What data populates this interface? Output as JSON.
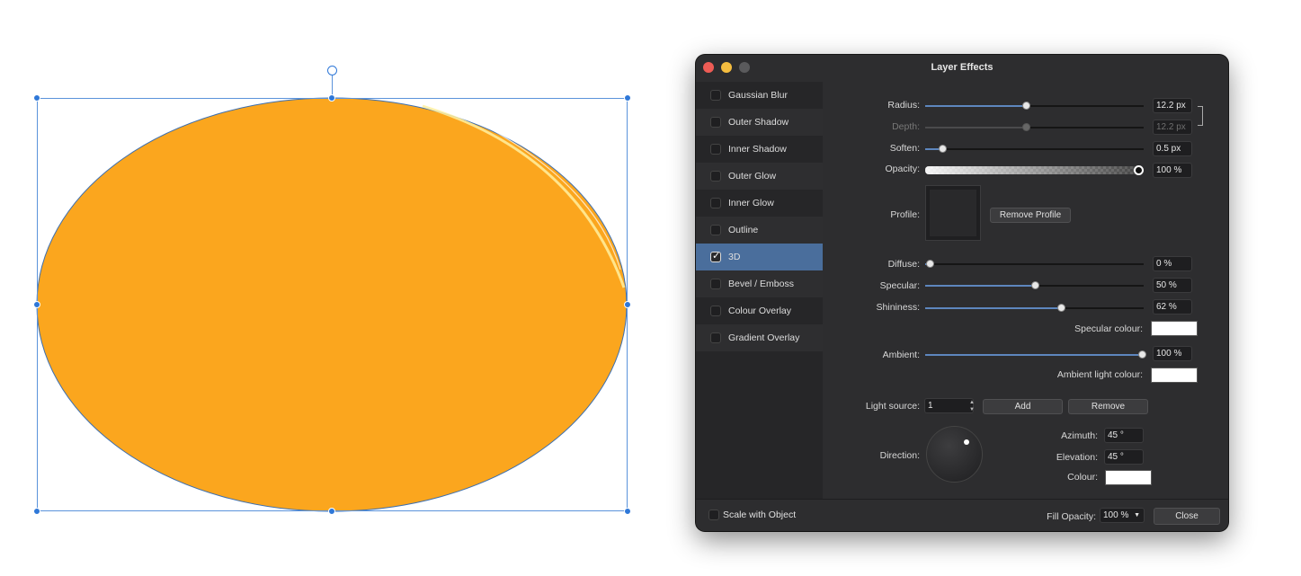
{
  "dialog": {
    "title": "Layer Effects",
    "traffic_lights": [
      "#ee5c55",
      "#f5bd3f",
      "#5a5a5c"
    ]
  },
  "canvas": {
    "shape_fill": "#fba61e",
    "shape_stroke": "#3c6fb0"
  },
  "effects": [
    {
      "label": "Gaussian Blur",
      "checked": false
    },
    {
      "label": "Outer Shadow",
      "checked": false
    },
    {
      "label": "Inner Shadow",
      "checked": false
    },
    {
      "label": "Outer Glow",
      "checked": false
    },
    {
      "label": "Inner Glow",
      "checked": false
    },
    {
      "label": "Outline",
      "checked": false
    },
    {
      "label": "3D",
      "checked": true
    },
    {
      "label": "Bevel / Emboss",
      "checked": false
    },
    {
      "label": "Colour Overlay",
      "checked": false
    },
    {
      "label": "Gradient Overlay",
      "checked": false
    }
  ],
  "settings": {
    "radius": {
      "label": "Radius:",
      "value": "12.2 px",
      "level": 0.46
    },
    "depth": {
      "label": "Depth:",
      "value": "12.2 px",
      "level": 0.46
    },
    "soften": {
      "label": "Soften:",
      "value": "0.5 px",
      "level": 0.08
    },
    "opacity": {
      "label": "Opacity:",
      "value": "100 %",
      "level": 1.0
    },
    "profile": {
      "label": "Profile:",
      "remove_label": "Remove Profile"
    },
    "diffuse": {
      "label": "Diffuse:",
      "value": "0 %",
      "level": 0.02
    },
    "specular": {
      "label": "Specular:",
      "value": "50 %",
      "level": 0.5
    },
    "shininess": {
      "label": "Shininess:",
      "value": "62 %",
      "level": 0.62
    },
    "specular_colour": {
      "label": "Specular colour:",
      "color": "#ffffff"
    },
    "ambient": {
      "label": "Ambient:",
      "value": "100 %",
      "level": 0.99
    },
    "ambient_light_colour": {
      "label": "Ambient light colour:",
      "color": "#ffffff"
    },
    "light_source": {
      "label": "Light source:",
      "value": "1",
      "add_label": "Add",
      "remove_label": "Remove"
    },
    "direction": {
      "label": "Direction:"
    },
    "azimuth": {
      "label": "Azimuth:",
      "value": "45 °"
    },
    "elevation": {
      "label": "Elevation:",
      "value": "45 °"
    },
    "colour": {
      "label": "Colour:",
      "color": "#ffffff"
    }
  },
  "footer": {
    "scale_with_object": "Scale with Object",
    "fill_opacity_label": "Fill Opacity:",
    "fill_opacity_value": "100 %",
    "close_label": "Close"
  }
}
